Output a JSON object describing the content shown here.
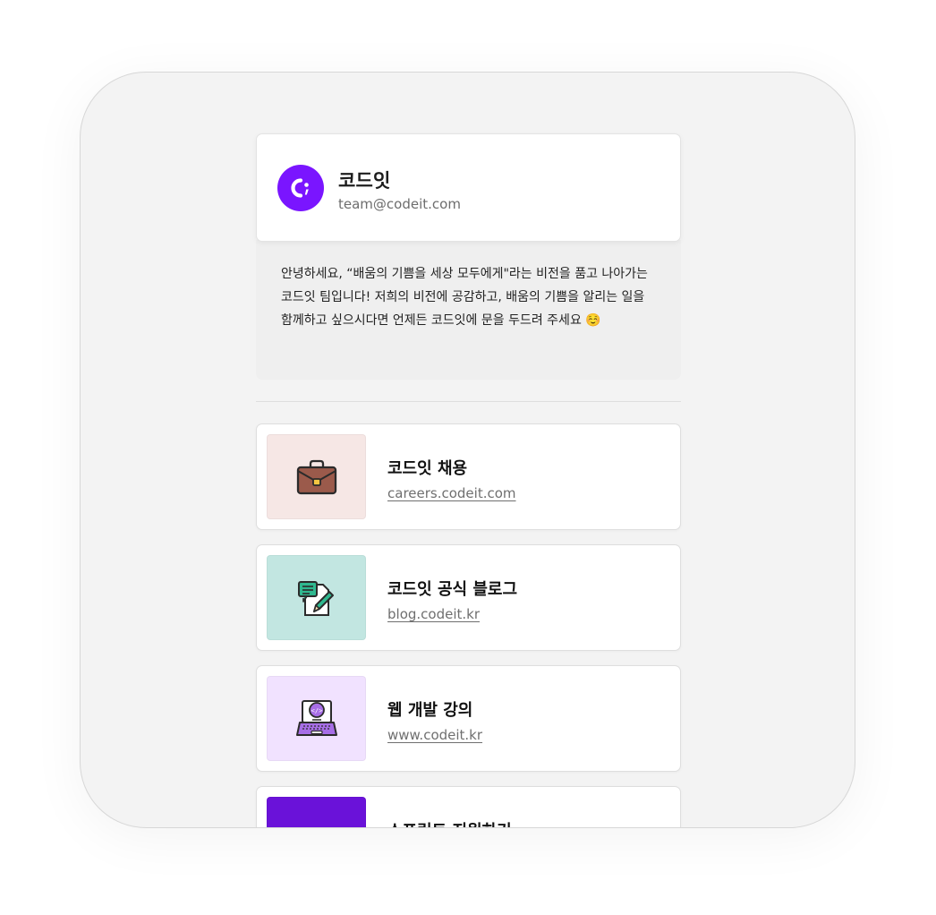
{
  "profile": {
    "name": "코드잇",
    "email": "team@codeit.com",
    "avatar_color": "#7A15FF"
  },
  "bio": "안녕하세요, “배움의 기쁨을 세상 모두에게\"라는 비전을 품고 나아가는 코드잇 팀입니다! 저희의 비전에 공감하고, 배움의 기쁨을 알리는 일을 함께하고 싶으시다면 언제든 코드잇에 문을 두드려 주세요 ☺️",
  "links": [
    {
      "title": "코드잇 채용",
      "url": "careers.codeit.com",
      "icon": "briefcase-icon",
      "thumb_color": "#F6E7E5"
    },
    {
      "title": "코드잇 공식 블로그",
      "url": "blog.codeit.kr",
      "icon": "document-edit-icon",
      "thumb_color": "#C2E6E1"
    },
    {
      "title": "웹 개발 강의",
      "url": "www.codeit.kr",
      "icon": "laptop-code-icon",
      "thumb_color": "#F1E2FF"
    },
    {
      "title": "스프린트 지원하기",
      "url": "",
      "icon": "sprint-image",
      "thumb_color": "#6A12D9"
    }
  ]
}
